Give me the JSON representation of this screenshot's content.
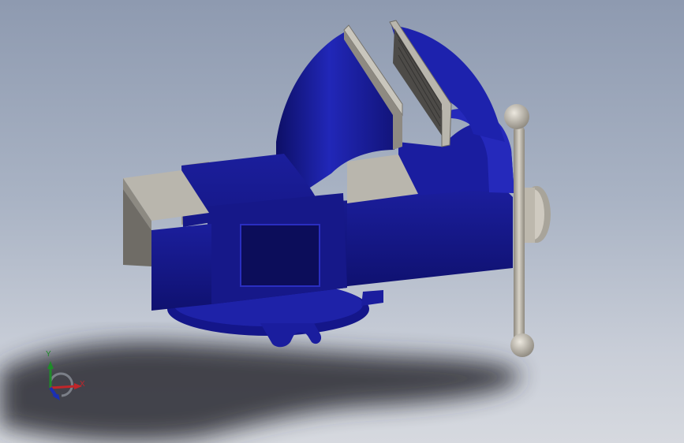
{
  "viewport": {
    "background_top": "#8e9ab0",
    "background_bottom": "#d6d9df"
  },
  "model": {
    "name_icon": "bench-vise-icon",
    "colors": {
      "body_blue": "#1c1e9a",
      "body_dark": "#0e0f63",
      "jaw_gray": "#b9b6ad",
      "handle_gray": "#bdb8ad"
    }
  },
  "triad": {
    "x_label": "X",
    "y_label": "Y",
    "x_color": "#c0262a",
    "y_color": "#1f8a2a",
    "z_color": "#1a2fb5"
  }
}
